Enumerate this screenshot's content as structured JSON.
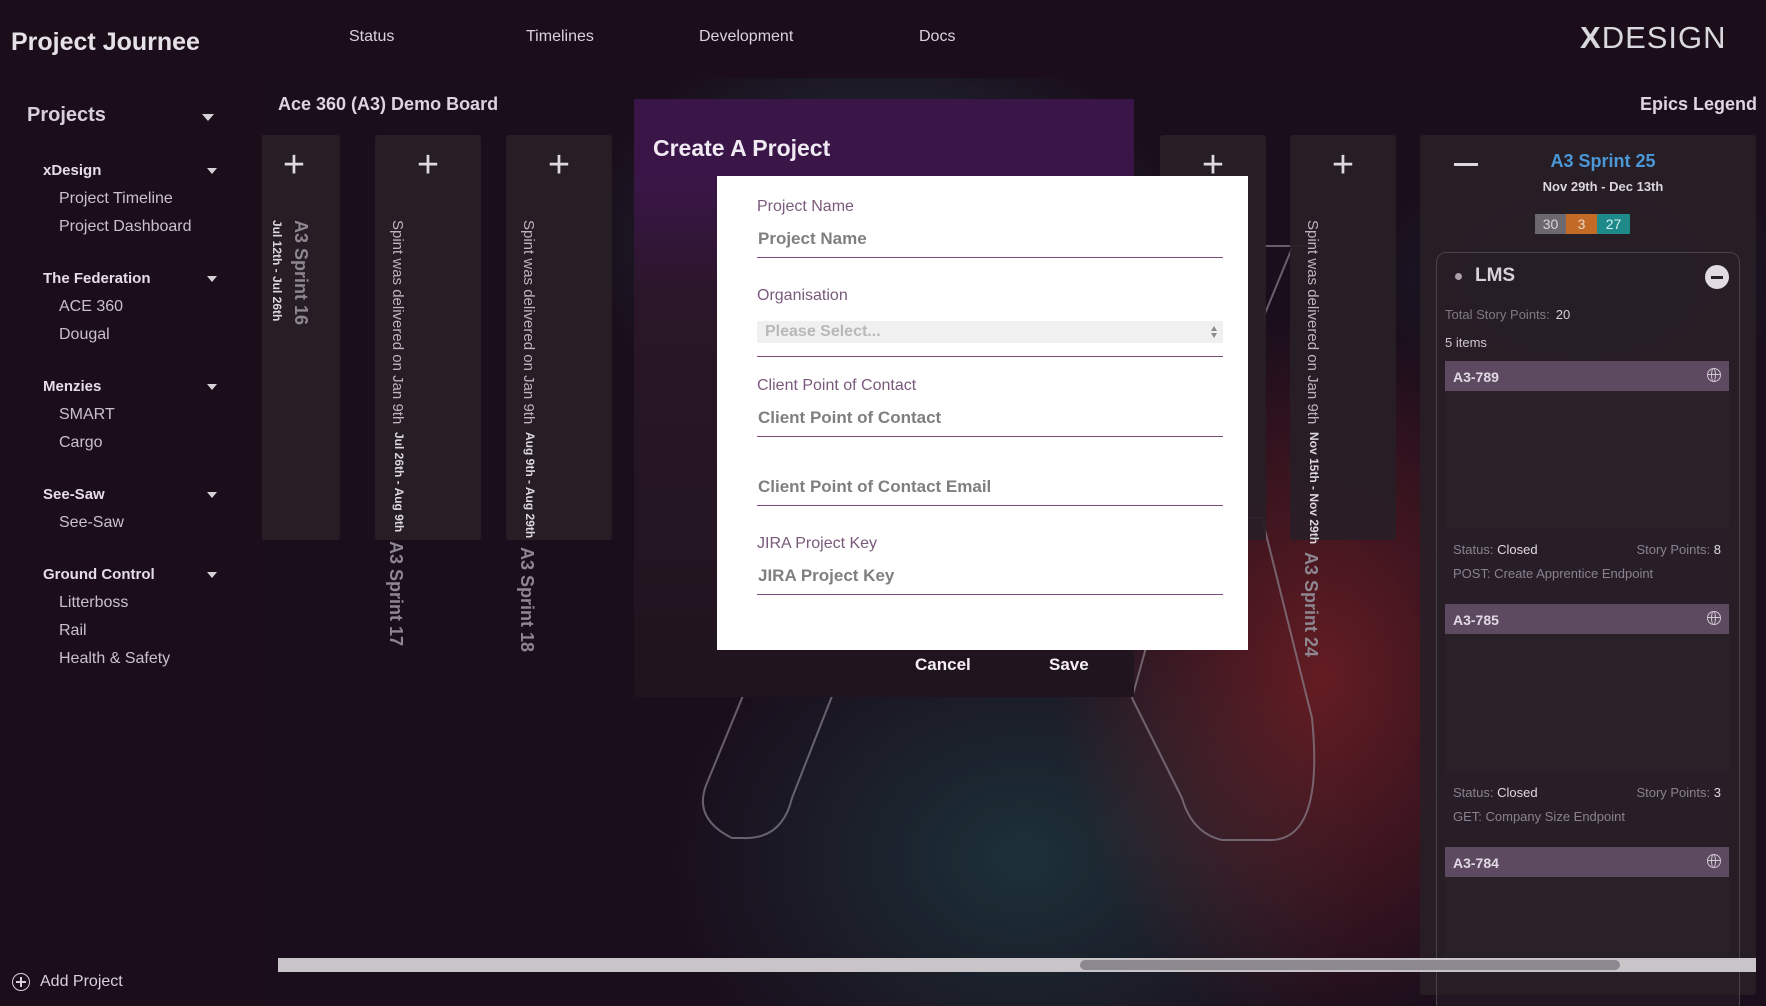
{
  "app": {
    "title": "Project Journee"
  },
  "sidebar": {
    "projects_label": "Projects",
    "groups": [
      {
        "name": "xDesign",
        "items": [
          "Project Timeline",
          "Project Dashboard"
        ]
      },
      {
        "name": "The Federation",
        "items": [
          "ACE 360",
          "Dougal"
        ]
      },
      {
        "name": "Menzies",
        "items": [
          "SMART",
          "Cargo"
        ]
      },
      {
        "name": "See-Saw",
        "items": [
          "See-Saw"
        ]
      },
      {
        "name": "Ground Control",
        "items": [
          "Litterboss",
          "Rail",
          "Health & Safety"
        ]
      }
    ],
    "add_project": "Add Project"
  },
  "nav": {
    "items": [
      "Status",
      "Timelines",
      "Development",
      "Docs"
    ],
    "logo_x": "X",
    "logo_text": "DESIGN"
  },
  "board": {
    "title": "Ace 360 (A3) Demo Board",
    "legend": "Epics Legend",
    "sprints": [
      {
        "name": "A3 Sprint 16",
        "dates": "Jul 12th - Jul 26th",
        "delivered": ""
      },
      {
        "name": "A3 Sprint 17",
        "dates": "Jul 26th - Aug 9th",
        "delivered": "Spint was delivered on Jan 9th"
      },
      {
        "name": "A3 Sprint 18",
        "dates": "Aug 9th - Aug 29th",
        "delivered": "Spint was delivered on Jan 9th"
      },
      {
        "name": "",
        "dates": "",
        "delivered": ""
      },
      {
        "name": "A3 Sprint 24",
        "dates": "Nov 15th - Nov 29th",
        "delivered": "Spint was delivered on Jan 9th"
      }
    ],
    "current_sprint": {
      "name": "A3 Sprint 25",
      "dates": "Nov 29th - Dec 13th",
      "points": [
        "30",
        "3",
        "27"
      ],
      "epic": {
        "name": "LMS",
        "total_label": "Total Story Points:",
        "total_value": "20",
        "items_count": "5 items",
        "tickets": [
          {
            "id": "A3-789",
            "status_label": "Status:",
            "status": "Closed",
            "sp_label": "Story Points:",
            "sp": "8",
            "desc": "POST: Create Apprentice Endpoint"
          },
          {
            "id": "A3-785",
            "status_label": "Status:",
            "status": "Closed",
            "sp_label": "Story Points:",
            "sp": "3",
            "desc": "GET: Company Size Endpoint"
          },
          {
            "id": "A3-784",
            "status_label": "",
            "status": "",
            "sp_label": "",
            "sp": "",
            "desc": ""
          }
        ]
      }
    }
  },
  "modal": {
    "title": "Create A Project",
    "fields": {
      "project_name": {
        "label": "Project Name",
        "placeholder": "Project Name"
      },
      "organisation": {
        "label": "Organisation",
        "placeholder": "Please Select..."
      },
      "client_contact": {
        "label": "Client Point of Contact",
        "placeholder": "Client Point of Contact"
      },
      "client_email": {
        "label": "",
        "placeholder": "Client Point of Contact Email"
      },
      "jira_key": {
        "label": "JIRA Project Key",
        "placeholder": "JIRA Project Key"
      }
    },
    "cancel": "Cancel",
    "save": "Save"
  }
}
